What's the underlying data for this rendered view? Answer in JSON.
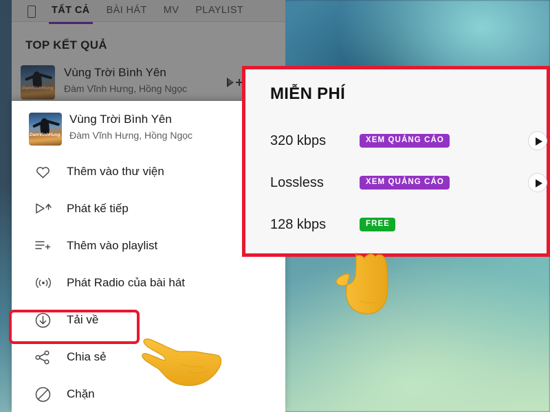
{
  "app": {
    "tabs": [
      {
        "label": "TẤT CẢ",
        "active": true
      },
      {
        "label": "BÀI HÁT",
        "active": false
      },
      {
        "label": "MV",
        "active": false
      },
      {
        "label": "PLAYLIST",
        "active": false
      }
    ],
    "device_icon": "device-icon",
    "section_heading": "TOP KẾT QUẢ",
    "result": {
      "title": "Vùng Trời Bình Yên",
      "artists": "Đàm Vĩnh Hưng, Hồng Ngọc",
      "thumb_watermark": "DamVinhHung",
      "queue_icon": "add-to-queue-icon"
    }
  },
  "menu": {
    "header": {
      "title": "Vùng Trời Bình Yên",
      "artists": "Đàm Vĩnh Hưng, Hồng Ngọc",
      "thumb_watermark": "DamVinhHung"
    },
    "items": [
      {
        "label": "Thêm vào thư viện",
        "icon": "heart-icon",
        "highlighted": false
      },
      {
        "label": "Phát kế tiếp",
        "icon": "play-next-icon",
        "highlighted": false
      },
      {
        "label": "Thêm vào playlist",
        "icon": "playlist-add-icon",
        "highlighted": false
      },
      {
        "label": "Phát Radio của bài hát",
        "icon": "radio-icon",
        "highlighted": false
      },
      {
        "label": "Tải về",
        "icon": "download-icon",
        "highlighted": true
      },
      {
        "label": "Chia sẻ",
        "icon": "share-icon",
        "highlighted": false
      },
      {
        "label": "Chặn",
        "icon": "block-icon",
        "highlighted": false
      }
    ]
  },
  "quality_panel": {
    "title": "MIỄN PHÍ",
    "rows": [
      {
        "name": "320 kbps",
        "badge": "XEM QUẢNG CÁO",
        "badge_type": "ad",
        "has_play": true
      },
      {
        "name": "Lossless",
        "badge": "XEM QUẢNG CÁO",
        "badge_type": "ad",
        "has_play": true
      },
      {
        "name": "128 kbps",
        "badge": "FREE",
        "badge_type": "free",
        "has_play": false
      }
    ]
  },
  "annotations": {
    "highlight_color": "#e8182f",
    "accent_tab_color": "#7b2fbe",
    "badge_ad_color": "#9333c4",
    "badge_free_color": "#0eab28",
    "pointer_left": "pointing-left-hand-emoji",
    "pointer_up": "pointing-up-hand-emoji"
  }
}
